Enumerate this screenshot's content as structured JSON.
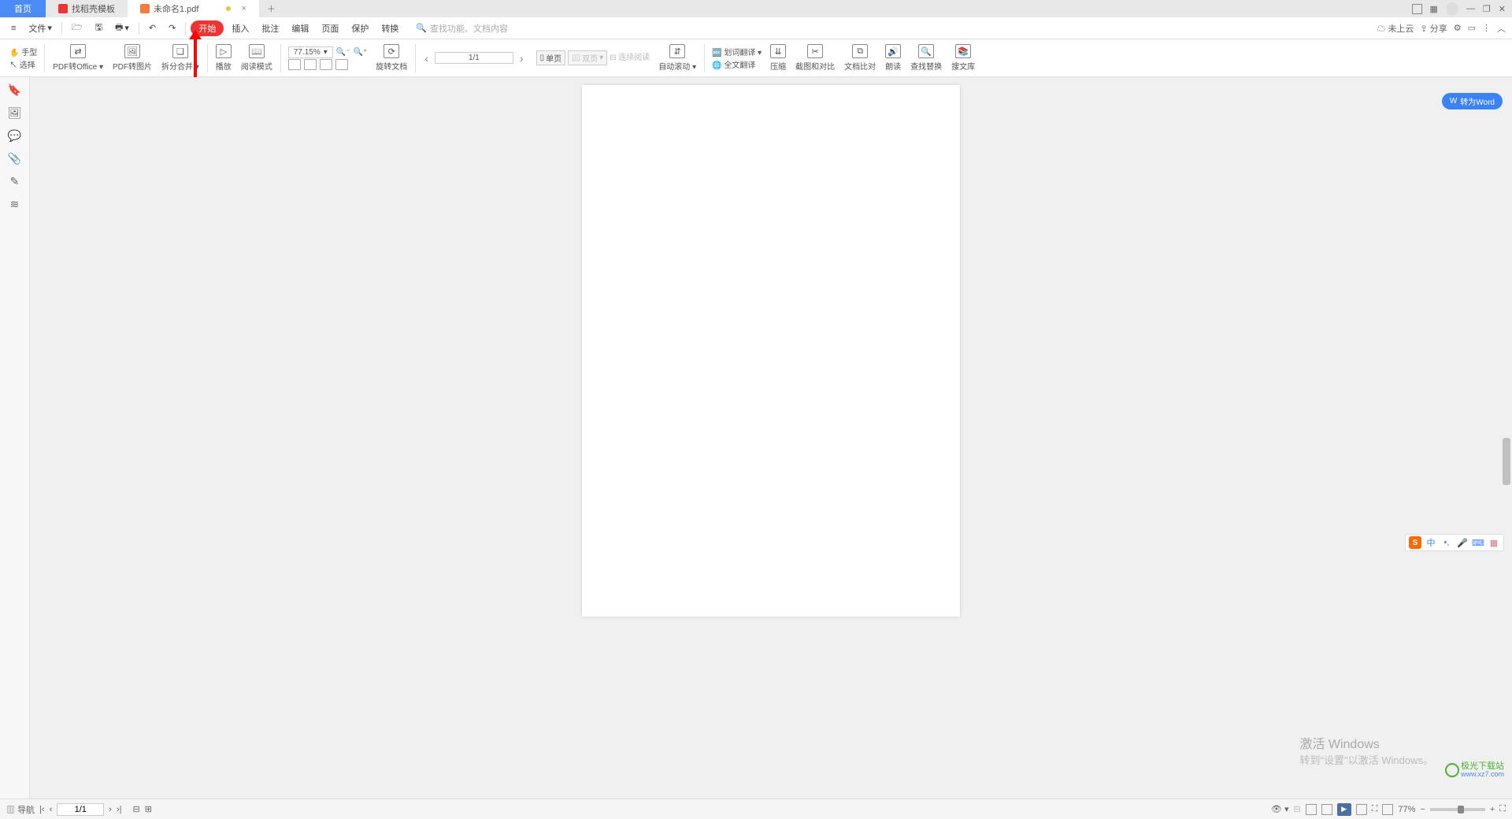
{
  "tabs": {
    "home": "首页",
    "templates": "找稻壳模板",
    "current": "未命名1.pdf"
  },
  "menu": {
    "file": "文件",
    "start": "开始",
    "insert": "插入",
    "annotate": "批注",
    "edit": "编辑",
    "page": "页面",
    "protect": "保护",
    "convert": "转换",
    "search_placeholder": "查找功能、文档内容",
    "not_cloud": "未上云",
    "share": "分享"
  },
  "ribbon": {
    "hand": "手型",
    "select": "选择",
    "pdf_to_office": "PDF转Office",
    "pdf_to_image": "PDF转图片",
    "split_merge": "拆分合并",
    "play": "播放",
    "read_mode": "阅读模式",
    "zoom": "77.15%",
    "rotate_doc": "旋转文档",
    "single_page": "单页",
    "double_page": "双页",
    "continuous": "连续阅读",
    "auto_scroll": "自动滚动",
    "word_translate": "划词翻译",
    "full_translate": "全文翻译",
    "compress": "压缩",
    "screenshot_compare": "截图和对比",
    "text_compare": "文档比对",
    "read_aloud": "朗读",
    "find_replace": "查找替换",
    "search_lib": "搜文库",
    "page_indicator": "1/1"
  },
  "right_pill": "转为Word",
  "watermark": {
    "line1": "激活 Windows",
    "line2": "转到\"设置\"以激活 Windows。"
  },
  "brand": {
    "name": "极光下载站",
    "url": "www.xz7.com"
  },
  "status": {
    "nav": "导航",
    "page": "1/1",
    "zoom": "77%"
  },
  "ime": {
    "zhong": "中",
    "dot": "•,",
    "smile": "☺"
  }
}
